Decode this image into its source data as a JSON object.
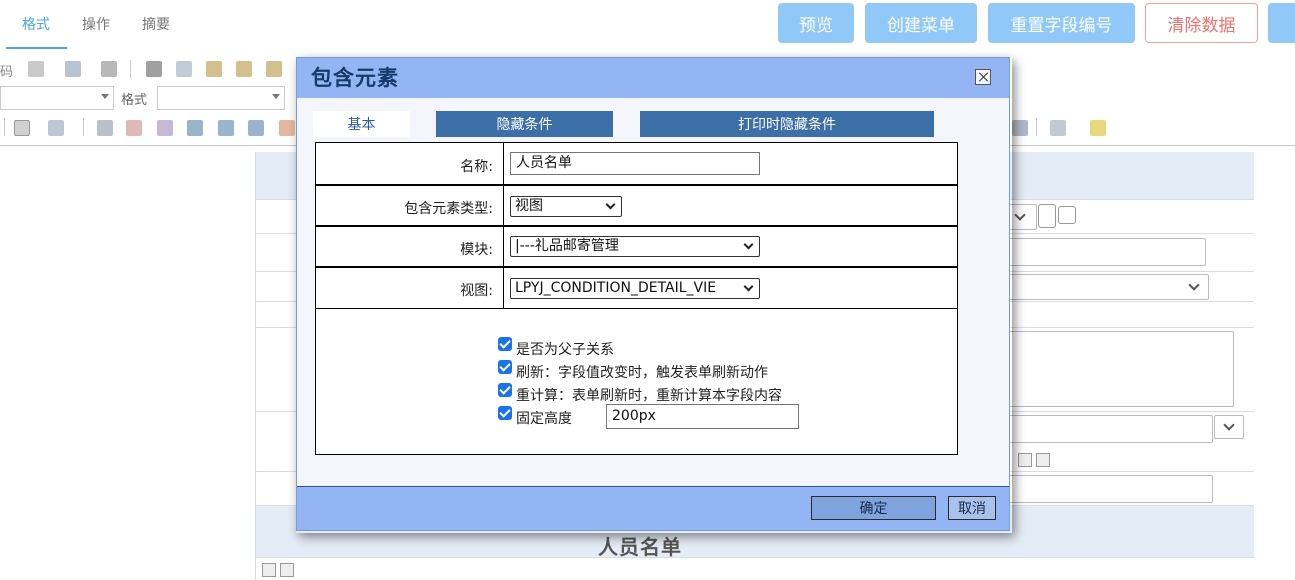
{
  "top_tabs": [
    "格式",
    "操作",
    "摘要"
  ],
  "top_buttons": {
    "preview": "预览",
    "create_menu": "创建菜单",
    "reset_field_numbers": "重置字段编号",
    "clear_data": "清除数据"
  },
  "toolbar": {
    "code_label": "码",
    "format_label": "格式"
  },
  "background": {
    "section_title": "人员名单"
  },
  "dialog": {
    "title": "包含元素",
    "tabs": [
      "基本",
      "隐藏条件",
      "打印时隐藏条件"
    ],
    "fields": {
      "name_label": "名称:",
      "name_value": "人员名单",
      "type_label": "包含元素类型:",
      "type_value": "视图",
      "module_label": "模块:",
      "module_value": "|---礼品邮寄管理",
      "view_label": "视图:",
      "view_value": "LPYJ_CONDITION_DETAIL_VIE"
    },
    "options": [
      {
        "label": "是否为父子关系",
        "checked": true
      },
      {
        "label": "刷新：字段值改变时，触发表单刷新动作",
        "checked": true
      },
      {
        "label": "重计算：表单刷新时，重新计算本字段内容",
        "checked": true
      },
      {
        "label": "固定高度",
        "checked": true
      }
    ],
    "fixed_height_value": "200px",
    "ok_label": "确定",
    "cancel_label": "取消"
  },
  "colors": {
    "accent_blue": "#90c8f7",
    "dialog_title_bg": "#94b5f3",
    "tab_dark": "#3c6ea8",
    "checkbox": "#1a73e8"
  }
}
